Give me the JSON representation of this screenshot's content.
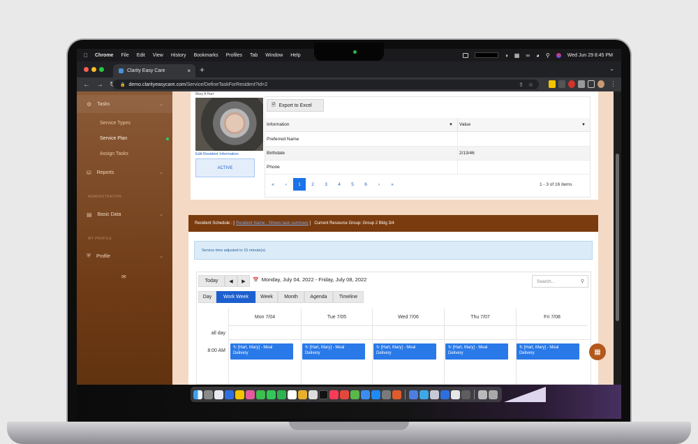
{
  "menubar": {
    "app": "Chrome",
    "items": [
      "File",
      "Edit",
      "View",
      "History",
      "Bookmarks",
      "Profiles",
      "Tab",
      "Window",
      "Help"
    ],
    "clock": "Wed Jun 29 8:45 PM"
  },
  "browser": {
    "tab_title": "Clarity Easy Care",
    "url_host": "demo.clarityeasycare.com",
    "url_path": "/Service/DefineTaskForResident?id=2"
  },
  "sidebar": {
    "tasks": "Tasks",
    "sub_items": [
      "Service Types",
      "Service Plan",
      "Assign Tasks"
    ],
    "reports": "Reports",
    "section_admin": "ADMINISTRATION",
    "basic_data": "Basic Data",
    "section_profile": "MY PROFILE",
    "profile": "Profile"
  },
  "resident": {
    "name": "Mary A Hart",
    "edit_link": "Edit Resident Information",
    "status": "ACTIVE"
  },
  "info_grid": {
    "export_label": "Export to Excel",
    "columns": [
      "Information",
      "Value"
    ],
    "rows": [
      {
        "info": "Preferred Name",
        "value": ""
      },
      {
        "info": "Birthdate",
        "value": "2/13/46"
      },
      {
        "info": "Phone",
        "value": ""
      }
    ],
    "pages": [
      "1",
      "2",
      "3",
      "4",
      "5",
      "6"
    ],
    "pager_info": "1 - 3 of 16 items"
  },
  "schedule": {
    "header_prefix": "Resident Schedule : [",
    "header_link": "Resident Name - Shows task summary",
    "header_suffix": "]",
    "resource_group": "Current Resource Group: Group 2 Bldg 3/4",
    "alert": "Service time adjusted to 15 minute(s).",
    "today": "Today",
    "date_range": "Monday, July 04, 2022 - Friday, July 08, 2022",
    "search_placeholder": "Search...",
    "views": [
      "Day",
      "Work Week",
      "Week",
      "Month",
      "Agenda",
      "Timeline"
    ],
    "selected_view": "Work Week",
    "days": [
      "Mon 7/04",
      "Tue 7/05",
      "Wed 7/06",
      "Thu 7/07",
      "Fri 7/08"
    ],
    "all_day": "all day",
    "time_slot": "8:00 AM",
    "event_line1": "[Hart, Mary] - Meal",
    "event_line2": "Delivery"
  }
}
